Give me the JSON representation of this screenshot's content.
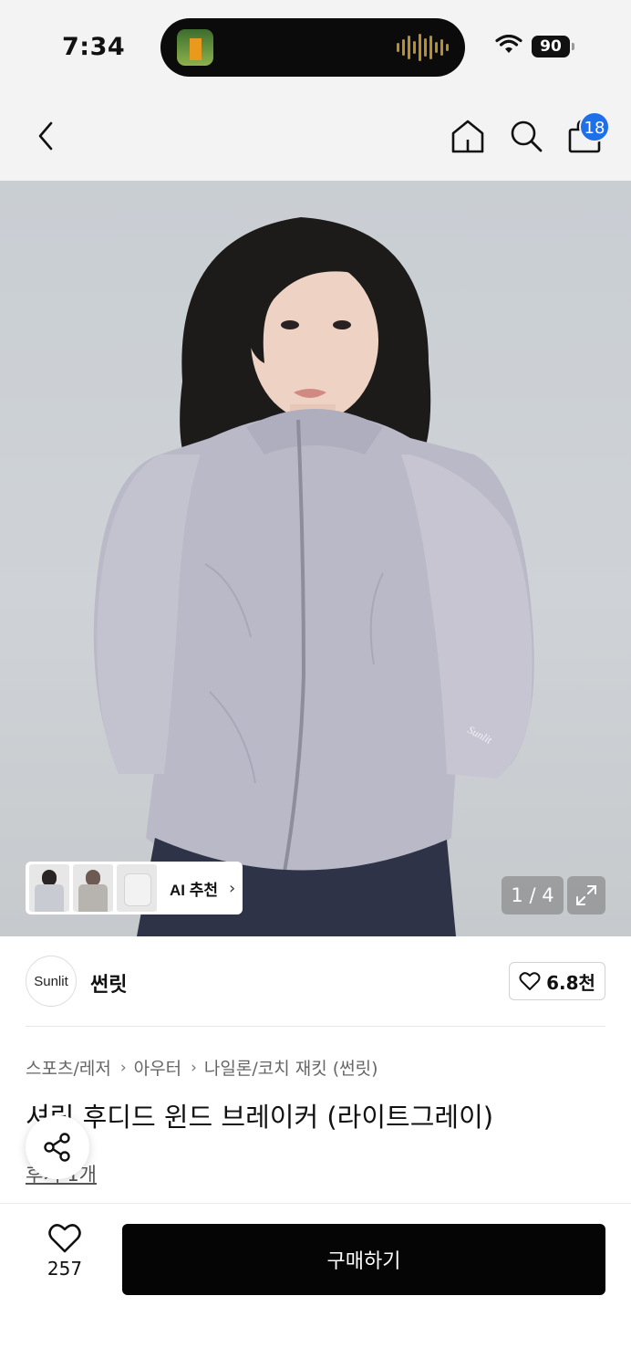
{
  "status_bar": {
    "time": "7:34",
    "battery": "90"
  },
  "header": {
    "cart_count": "18"
  },
  "gallery": {
    "page_indicator": "1 / 4",
    "ai_recommend_label": "AI 추천",
    "logo_text": "Sunlit"
  },
  "brand": {
    "logo_text": "Sunlit",
    "name": "썬릿",
    "like_count": "6.8천"
  },
  "breadcrumb": [
    "스포츠/레저",
    "아우터",
    "나일론/코치 재킷 (썬릿)"
  ],
  "product": {
    "title": "셔링 후디드 윈드 브레이커 (라이트그레이)",
    "reviews_link": "후기 1개"
  },
  "bottom_bar": {
    "wish_count": "257",
    "buy_label": "구매하기"
  },
  "colors": {
    "accent_blue": "#1f6fe8",
    "buy_button": "#050505"
  },
  "icons": [
    "back-icon",
    "home-icon",
    "search-icon",
    "bag-icon",
    "expand-icon",
    "heart-icon",
    "share-icon",
    "wifi-icon"
  ]
}
